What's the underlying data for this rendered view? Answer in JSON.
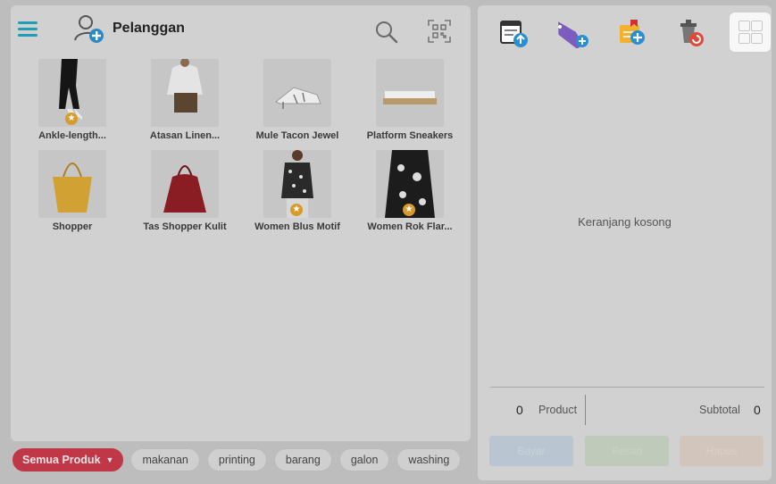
{
  "header": {
    "customer_label": "Pelanggan"
  },
  "products": [
    {
      "name": "Ankle-length...",
      "featured": true,
      "image": "black-pants"
    },
    {
      "name": "Atasan Linen...",
      "featured": false,
      "image": "white-blouse"
    },
    {
      "name": "Mule Tacon Jewel",
      "featured": false,
      "image": "white-mule"
    },
    {
      "name": "Platform Sneakers",
      "featured": false,
      "image": "white-sneakers"
    },
    {
      "name": "Shopper",
      "featured": false,
      "image": "yellow-bag"
    },
    {
      "name": "Tas Shopper Kulit",
      "featured": false,
      "image": "red-bag"
    },
    {
      "name": "Women Blus Motif",
      "featured": true,
      "image": "floral-top"
    },
    {
      "name": "Women Rok Flar...",
      "featured": true,
      "image": "floral-skirt"
    }
  ],
  "categories": {
    "active": "Semua Produk",
    "items": [
      "makanan",
      "printing",
      "barang",
      "galon",
      "washing"
    ]
  },
  "cart": {
    "empty_text": "Keranjang kosong",
    "count": "0",
    "count_label": "Product",
    "subtotal_label": "Subtotal",
    "subtotal_value": "0"
  },
  "actions": {
    "pay": "Bayar",
    "order": "Pesan",
    "delete": "Hapus"
  },
  "colors": {
    "accent": "#1e9fb5",
    "active_chip": "#c03848",
    "star": "#d89a2a"
  }
}
